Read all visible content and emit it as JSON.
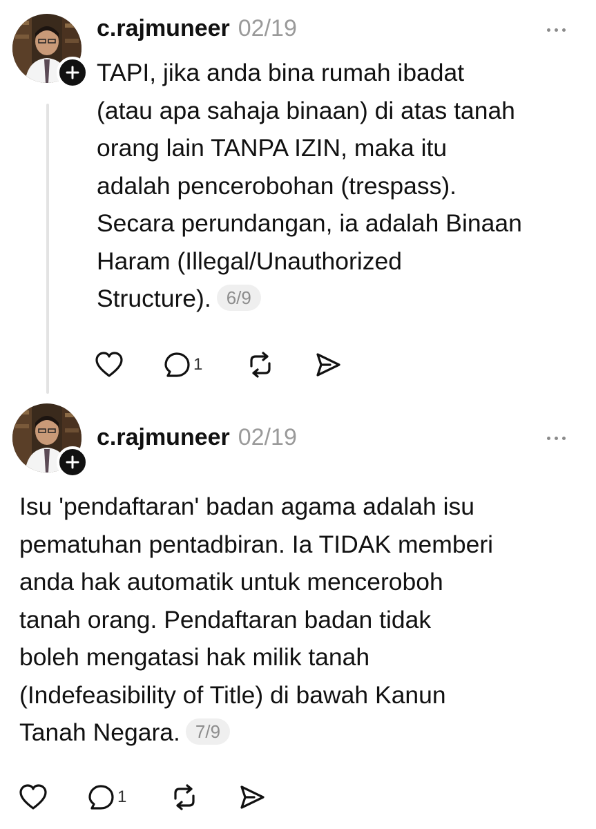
{
  "posts": [
    {
      "username": "c.rajmuneer",
      "date": "02/19",
      "lines": [
        "TAPI, jika anda bina rumah ibadat",
        "(atau apa sahaja binaan) di atas tanah",
        "orang lain TANPA IZIN, maka itu",
        "adalah pencerobohan (trespass).",
        "Secara perundangan, ia adalah Binaan",
        "Haram (Illegal/Unauthorized",
        "Structure)."
      ],
      "counter": "6/9",
      "reply_count": "1",
      "icons": [
        "heart-icon",
        "comment-icon",
        "repost-icon",
        "share-icon",
        "more-icon",
        "follow-plus-icon"
      ]
    },
    {
      "username": "c.rajmuneer",
      "date": "02/19",
      "lines": [
        "Isu 'pendaftaran' badan agama adalah isu",
        "pematuhan pentadbiran. Ia TIDAK memberi",
        "anda hak automatik untuk menceroboh",
        "tanah orang. Pendaftaran badan tidak",
        "boleh mengatasi hak milik tanah",
        "(Indefeasibility of Title) di bawah Kanun",
        "Tanah Negara."
      ],
      "counter": "7/9",
      "reply_count": "1",
      "icons": [
        "heart-icon",
        "comment-icon",
        "repost-icon",
        "share-icon",
        "more-icon",
        "follow-plus-icon"
      ]
    }
  ]
}
